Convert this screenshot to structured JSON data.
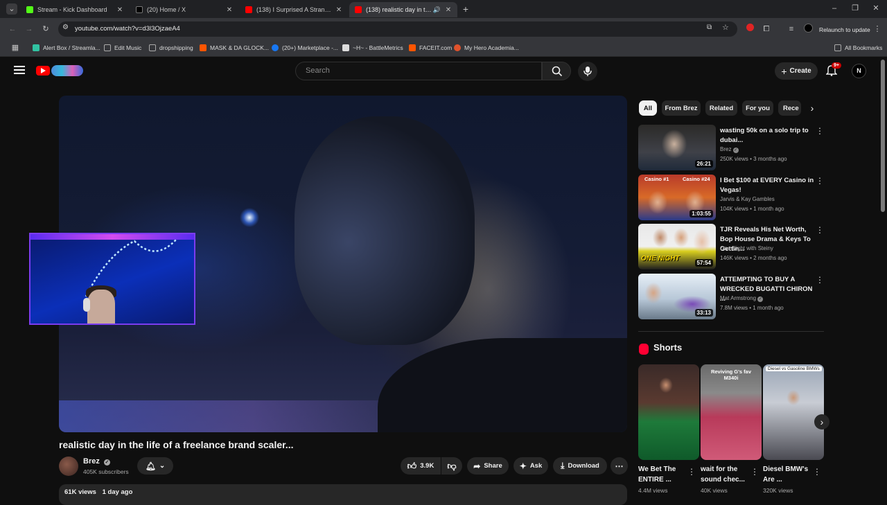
{
  "browser": {
    "tabs": [
      {
        "label": "Stream - Kick Dashboard",
        "color": "#53fc18"
      },
      {
        "label": "(20) Home / X",
        "color": "#000000"
      },
      {
        "label": "(138) I Surprised A Stranger Wi...",
        "color": "#ff0000"
      },
      {
        "label": "(138) realistic day in the life",
        "color": "#ff0000"
      }
    ],
    "new_tab": "+",
    "url": "youtube.com/watch?v=d3l3OjzaeA4",
    "relaunch": "Relaunch to update",
    "bookmarks": [
      {
        "label": "Alert Box / Streamla...",
        "color": "#31c3a2"
      },
      {
        "label": "Edit Music",
        "color": "#aaaaaa"
      },
      {
        "label": "dropshipping",
        "color": "#aaaaaa"
      },
      {
        "label": "MASK & DA GLOCK...",
        "color": "#ff5500"
      },
      {
        "label": "(20+) Marketplace -...",
        "color": "#1877f2"
      },
      {
        "label": "~H~ - BattleMetrics",
        "color": "#dddddd"
      },
      {
        "label": "FACEIT.com",
        "color": "#ff5500"
      },
      {
        "label": "My Hero Academia...",
        "color": "#e0522c"
      }
    ],
    "all_bookmarks": "All Bookmarks"
  },
  "youtube": {
    "search_placeholder": "Search",
    "create_label": "Create",
    "notif_badge": "9+",
    "avatar_letter": "N"
  },
  "video": {
    "title": "realistic day in the life of a freelance brand scaler...",
    "channel": "Brez",
    "subscribers": "405K subscribers",
    "likes": "3.9K",
    "share": "Share",
    "ask": "Ask",
    "download": "Download",
    "views": "61K views",
    "age": "1 day ago"
  },
  "chips": [
    "All",
    "From Brez",
    "Related",
    "For you",
    "Rece"
  ],
  "recommendations": [
    {
      "title": "wasting 50k on a solo trip to dubai...",
      "channel": "Brez",
      "verified": true,
      "meta": "250K views • 3 months ago",
      "duration": "26:21"
    },
    {
      "title": "I Bet $100 at EVERY Casino in Vegas!",
      "channel": "Jarvis & Kay Gambles",
      "verified": false,
      "meta": "104K views • 1 month ago",
      "duration": "1:03:55"
    },
    {
      "title": "TJR Reveals His Net Worth, Bop House Drama & Keys To Gettin...",
      "channel": "One Night with Steiny",
      "verified": false,
      "meta": "146K views • 2 months ago",
      "duration": "57:54"
    },
    {
      "title": "ATTEMPTING TO BUY A WRECKED BUGATTI CHIRON ...",
      "channel": "Mat Armstrong",
      "verified": true,
      "meta": "7.8M views • 1 month ago",
      "duration": "33:13"
    }
  ],
  "thumb_texts": {
    "casino_a": "Casino #1",
    "casino_b": "Casino #24",
    "one_night": "ONE NIGHT"
  },
  "shorts": {
    "heading": "Shorts",
    "items": [
      {
        "title": "We Bet The ENTIRE ...",
        "views": "4.4M views",
        "overlay": ""
      },
      {
        "title": "wait for the sound chec...",
        "views": "40K views",
        "overlay": "Reviving G's fav M340i"
      },
      {
        "title": "Diesel BMW's Are ...",
        "views": "320K views",
        "overlay": "Diesel vs Gasoline BMWs"
      }
    ]
  }
}
